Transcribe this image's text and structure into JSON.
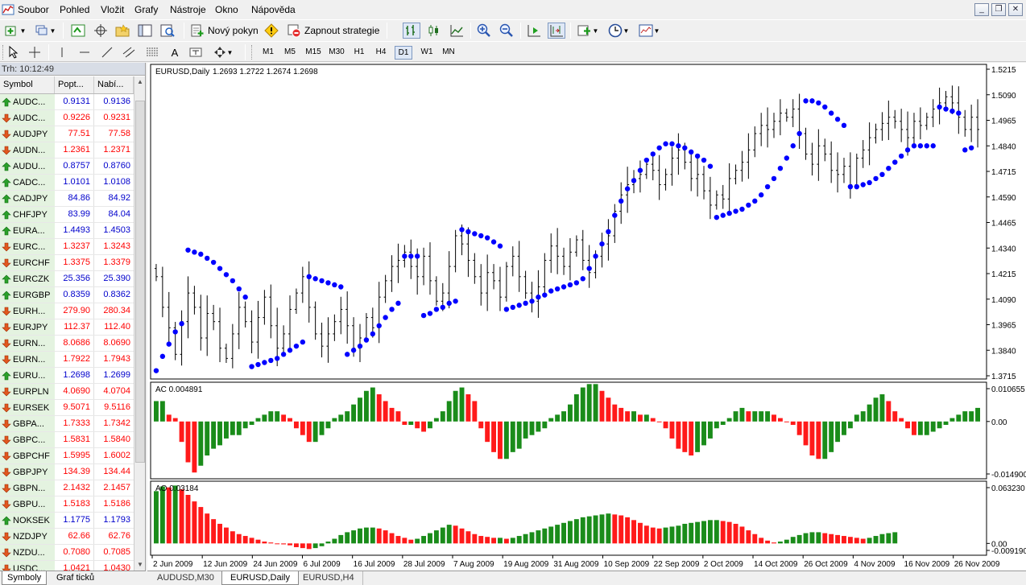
{
  "menu": [
    "Soubor",
    "Pohled",
    "Vložit",
    "Grafy",
    "Nástroje",
    "Okno",
    "Nápověda"
  ],
  "toolbar": {
    "new_order": "Nový pokyn",
    "auto_trading": "Zapnout strategie"
  },
  "timeframes": [
    "M1",
    "M5",
    "M15",
    "M30",
    "H1",
    "H4",
    "D1",
    "W1",
    "MN"
  ],
  "active_timeframe": "D1",
  "market_watch": {
    "title": "Trh: 10:12:49",
    "headers": [
      "Symbol",
      "Popt...",
      "Nabí..."
    ],
    "rows": [
      {
        "symbol": "AUDC...",
        "bid": "0.9131",
        "ask": "0.9136",
        "dir": "up"
      },
      {
        "symbol": "AUDC...",
        "bid": "0.9226",
        "ask": "0.9231",
        "dir": "down"
      },
      {
        "symbol": "AUDJPY",
        "bid": "77.51",
        "ask": "77.58",
        "dir": "down"
      },
      {
        "symbol": "AUDN...",
        "bid": "1.2361",
        "ask": "1.2371",
        "dir": "down"
      },
      {
        "symbol": "AUDU...",
        "bid": "0.8757",
        "ask": "0.8760",
        "dir": "up"
      },
      {
        "symbol": "CADC...",
        "bid": "1.0101",
        "ask": "1.0108",
        "dir": "up"
      },
      {
        "symbol": "CADJPY",
        "bid": "84.86",
        "ask": "84.92",
        "dir": "up"
      },
      {
        "symbol": "CHFJPY",
        "bid": "83.99",
        "ask": "84.04",
        "dir": "up"
      },
      {
        "symbol": "EURA...",
        "bid": "1.4493",
        "ask": "1.4503",
        "dir": "up"
      },
      {
        "symbol": "EURC...",
        "bid": "1.3237",
        "ask": "1.3243",
        "dir": "down"
      },
      {
        "symbol": "EURCHF",
        "bid": "1.3375",
        "ask": "1.3379",
        "dir": "down"
      },
      {
        "symbol": "EURCZK",
        "bid": "25.356",
        "ask": "25.390",
        "dir": "up"
      },
      {
        "symbol": "EURGBP",
        "bid": "0.8359",
        "ask": "0.8362",
        "dir": "up"
      },
      {
        "symbol": "EURH...",
        "bid": "279.90",
        "ask": "280.34",
        "dir": "down"
      },
      {
        "symbol": "EURJPY",
        "bid": "112.37",
        "ask": "112.40",
        "dir": "down"
      },
      {
        "symbol": "EURN...",
        "bid": "8.0686",
        "ask": "8.0690",
        "dir": "down"
      },
      {
        "symbol": "EURN...",
        "bid": "1.7922",
        "ask": "1.7943",
        "dir": "down"
      },
      {
        "symbol": "EURU...",
        "bid": "1.2698",
        "ask": "1.2699",
        "dir": "up"
      },
      {
        "symbol": "EURPLN",
        "bid": "4.0690",
        "ask": "4.0704",
        "dir": "down"
      },
      {
        "symbol": "EURSEK",
        "bid": "9.5071",
        "ask": "9.5116",
        "dir": "down"
      },
      {
        "symbol": "GBPA...",
        "bid": "1.7333",
        "ask": "1.7342",
        "dir": "down"
      },
      {
        "symbol": "GBPC...",
        "bid": "1.5831",
        "ask": "1.5840",
        "dir": "down"
      },
      {
        "symbol": "GBPCHF",
        "bid": "1.5995",
        "ask": "1.6002",
        "dir": "down"
      },
      {
        "symbol": "GBPJPY",
        "bid": "134.39",
        "ask": "134.44",
        "dir": "down"
      },
      {
        "symbol": "GBPN...",
        "bid": "2.1432",
        "ask": "2.1457",
        "dir": "down"
      },
      {
        "symbol": "GBPU...",
        "bid": "1.5183",
        "ask": "1.5186",
        "dir": "down"
      },
      {
        "symbol": "NOKSEK",
        "bid": "1.1775",
        "ask": "1.1793",
        "dir": "up"
      },
      {
        "symbol": "NZDJPY",
        "bid": "62.66",
        "ask": "62.76",
        "dir": "down"
      },
      {
        "symbol": "NZDU...",
        "bid": "0.7080",
        "ask": "0.7085",
        "dir": "down"
      },
      {
        "symbol": "USDC...",
        "bid": "1.0421",
        "ask": "1.0430",
        "dir": "down"
      }
    ],
    "tabs": [
      "Symboly",
      "Graf ticků"
    ]
  },
  "chart_tabs": [
    "AUDUSD,M30",
    "EURUSD,Daily",
    "EURUSD,H4"
  ],
  "active_chart_tab": "EURUSD,Daily",
  "colors": {
    "up": "#0000cc",
    "down": "#ff0000",
    "ac_up": "#1a8c1a",
    "ac_down": "#ff1a1a",
    "psar": "#0000ff",
    "bars": "#000000"
  },
  "chart_data": [
    {
      "type": "ohlc",
      "title": "EURUSD,Daily",
      "last_ohlc": "1.2693 1.2722 1.2674 1.2698",
      "y_ticks": [
        "1.5215",
        "1.5090",
        "1.4965",
        "1.4840",
        "1.4715",
        "1.4590",
        "1.4465",
        "1.4340",
        "1.4215",
        "1.4090",
        "1.3965",
        "1.3840",
        "1.3715"
      ],
      "ylim": [
        1.3715,
        1.5215
      ],
      "x_ticks": [
        "2 Jun 2009",
        "12 Jun 2009",
        "24 Jun 2009",
        "6 Jul 2009",
        "16 Jul 2009",
        "28 Jul 2009",
        "7 Aug 2009",
        "19 Aug 2009",
        "31 Aug 2009",
        "10 Sep 2009",
        "22 Sep 2009",
        "2 Oct 2009",
        "14 Oct 2009",
        "26 Oct 2009",
        "4 Nov 2009",
        "16 Nov 2009",
        "26 Nov 2009"
      ],
      "close": [
        1.42,
        1.405,
        1.395,
        1.382,
        1.398,
        1.412,
        1.405,
        1.39,
        1.402,
        1.398,
        1.385,
        1.38,
        1.392,
        1.405,
        1.398,
        1.388,
        1.4,
        1.41,
        1.396,
        1.385,
        1.392,
        1.404,
        1.412,
        1.42,
        1.405,
        1.392,
        1.386,
        1.392,
        1.398,
        1.404,
        1.396,
        1.385,
        1.39,
        1.4,
        1.395,
        1.41,
        1.418,
        1.425,
        1.428,
        1.432,
        1.425,
        1.42,
        1.43,
        1.418,
        1.408,
        1.412,
        1.425,
        1.44,
        1.436,
        1.428,
        1.42,
        1.412,
        1.422,
        1.418,
        1.41,
        1.425,
        1.43,
        1.42,
        1.412,
        1.408,
        1.415,
        1.428,
        1.435,
        1.43,
        1.425,
        1.432,
        1.438,
        1.428,
        1.422,
        1.43,
        1.436,
        1.44,
        1.452,
        1.46,
        1.465,
        1.468,
        1.47,
        1.475,
        1.472,
        1.465,
        1.47,
        1.478,
        1.482,
        1.476,
        1.468,
        1.47,
        1.462,
        1.455,
        1.46,
        1.458,
        1.468,
        1.472,
        1.476,
        1.482,
        1.49,
        1.494,
        1.492,
        1.496,
        1.5,
        1.498,
        1.502,
        1.49,
        1.48,
        1.475,
        1.484,
        1.48,
        1.472,
        1.47,
        1.474,
        1.465,
        1.478,
        1.482,
        1.488,
        1.492,
        1.495,
        1.498,
        1.496,
        1.492,
        1.488,
        1.496,
        1.494,
        1.498,
        1.502,
        1.505,
        1.508,
        1.505,
        1.498,
        1.492,
        1.498,
        1.492
      ],
      "psar": [
        1.374,
        1.381,
        1.387,
        1.393,
        1.397,
        1.433,
        1.432,
        1.431,
        1.429,
        1.427,
        1.424,
        1.421,
        1.418,
        1.414,
        1.41,
        1.376,
        1.377,
        1.378,
        1.379,
        1.38,
        1.382,
        1.384,
        1.386,
        1.388,
        1.42,
        1.419,
        1.418,
        1.417,
        1.416,
        1.415,
        1.382,
        1.384,
        1.386,
        1.389,
        1.392,
        1.396,
        1.4,
        1.404,
        1.407,
        1.43,
        1.43,
        1.43,
        1.401,
        1.402,
        1.404,
        1.405,
        1.407,
        1.408,
        1.443,
        1.442,
        1.441,
        1.44,
        1.439,
        1.437,
        1.435,
        1.404,
        1.405,
        1.406,
        1.407,
        1.408,
        1.41,
        1.411,
        1.413,
        1.414,
        1.415,
        1.416,
        1.417,
        1.419,
        1.424,
        1.43,
        1.436,
        1.442,
        1.45,
        1.457,
        1.463,
        1.467,
        1.472,
        1.477,
        1.48,
        1.483,
        1.485,
        1.485,
        1.484,
        1.483,
        1.481,
        1.479,
        1.477,
        1.474,
        1.449,
        1.45,
        1.451,
        1.452,
        1.453,
        1.455,
        1.457,
        1.46,
        1.464,
        1.468,
        1.473,
        1.478,
        1.484,
        1.49,
        1.506,
        1.506,
        1.505,
        1.503,
        1.5,
        1.497,
        1.494,
        1.464,
        1.464,
        1.465,
        1.466,
        1.468,
        1.47,
        1.473,
        1.476,
        1.479,
        1.482,
        1.484,
        1.484,
        1.484,
        1.484,
        1.503,
        1.502,
        1.501,
        1.5,
        1.482,
        1.483
      ]
    },
    {
      "type": "bar",
      "title": "AC 0.004891",
      "y_ticks": [
        "0.010655",
        "0.00",
        "-0.014900"
      ],
      "ylim": [
        -0.0159,
        0.0106
      ],
      "values": [
        0.006,
        0.006,
        0.002,
        0.001,
        -0.006,
        -0.012,
        -0.015,
        -0.013,
        -0.01,
        -0.008,
        -0.007,
        -0.005,
        -0.004,
        -0.004,
        -0.002,
        -0.001,
        0.001,
        0.002,
        0.003,
        0.003,
        0.002,
        0.001,
        -0.002,
        -0.004,
        -0.006,
        -0.006,
        -0.004,
        -0.002,
        0.001,
        0.002,
        0.003,
        0.005,
        0.007,
        0.009,
        0.01,
        0.008,
        0.006,
        0.004,
        0.003,
        -0.001,
        -0.001,
        -0.002,
        -0.003,
        -0.002,
        0.001,
        0.003,
        0.006,
        0.009,
        0.01,
        0.008,
        0.006,
        -0.002,
        -0.006,
        -0.009,
        -0.011,
        -0.011,
        -0.009,
        -0.008,
        -0.005,
        -0.004,
        -0.003,
        -0.002,
        0.001,
        0.002,
        0.003,
        0.005,
        0.008,
        0.01,
        0.011,
        0.011,
        0.009,
        0.007,
        0.005,
        0.004,
        0.003,
        0.003,
        0.002,
        0.002,
        0.001,
        0.0,
        -0.002,
        -0.005,
        -0.008,
        -0.009,
        -0.01,
        -0.009,
        -0.007,
        -0.005,
        -0.002,
        -0.001,
        0.001,
        0.003,
        0.004,
        0.003,
        0.003,
        0.003,
        0.003,
        0.002,
        0.001,
        0.0,
        -0.001,
        -0.004,
        -0.007,
        -0.01,
        -0.011,
        -0.011,
        -0.009,
        -0.006,
        -0.004,
        -0.002,
        0.002,
        0.003,
        0.005,
        0.007,
        0.008,
        0.006,
        0.003,
        0.001,
        -0.002,
        -0.004,
        -0.004,
        -0.004,
        -0.003,
        -0.002,
        -0.001,
        0.001,
        0.002,
        0.003,
        0.003,
        0.004
      ]
    },
    {
      "type": "bar",
      "title": "AO 0.03184",
      "y_ticks": [
        "0.063230",
        "0.00",
        "-0.009190"
      ],
      "ylim": [
        -0.0092,
        0.0632
      ],
      "values": [
        0.056,
        0.061,
        0.06,
        0.062,
        0.058,
        0.052,
        0.045,
        0.039,
        0.032,
        0.026,
        0.021,
        0.017,
        0.013,
        0.01,
        0.008,
        0.006,
        0.004,
        0.002,
        0.001,
        0.0,
        -0.001,
        -0.002,
        -0.004,
        -0.005,
        -0.006,
        -0.005,
        -0.003,
        0.002,
        0.005,
        0.009,
        0.012,
        0.014,
        0.016,
        0.017,
        0.017,
        0.016,
        0.014,
        0.011,
        0.008,
        0.006,
        0.004,
        0.005,
        0.008,
        0.011,
        0.014,
        0.017,
        0.02,
        0.019,
        0.016,
        0.013,
        0.01,
        0.008,
        0.007,
        0.006,
        0.006,
        0.005,
        0.006,
        0.008,
        0.01,
        0.012,
        0.014,
        0.016,
        0.018,
        0.02,
        0.022,
        0.024,
        0.026,
        0.028,
        0.029,
        0.03,
        0.031,
        0.032,
        0.031,
        0.03,
        0.028,
        0.025,
        0.022,
        0.019,
        0.017,
        0.016,
        0.017,
        0.018,
        0.019,
        0.021,
        0.022,
        0.023,
        0.024,
        0.025,
        0.025,
        0.024,
        0.023,
        0.021,
        0.018,
        0.014,
        0.01,
        0.006,
        0.003,
        0.001,
        0.002,
        0.004,
        0.007,
        0.009,
        0.011,
        0.012,
        0.012,
        0.011,
        0.01,
        0.009,
        0.008,
        0.007,
        0.006,
        0.005,
        0.006,
        0.008,
        0.01,
        0.011,
        0.012
      ]
    }
  ]
}
